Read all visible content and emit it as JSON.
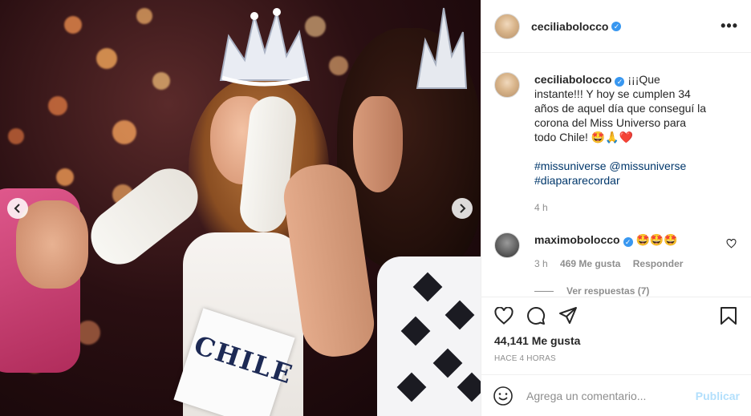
{
  "post": {
    "author": "ceciliabolocco",
    "more_label": "•••"
  },
  "caption": {
    "username": "ceciliabolocco",
    "text": " ¡¡¡Que instante!!! Y hoy se cumplen 34 años de aquel día que conseguí la corona del Miss Universo para todo Chile! 🤩🙏❤️",
    "hashtag1": "#missuniverse",
    "mention": "@missuniverse",
    "hashtag2": "#diapararecordar",
    "time": "4 h"
  },
  "reply": {
    "username": "maximobolocco",
    "text": " 🤩🤩🤩",
    "time": "3 h",
    "likes": "469 Me gusta",
    "reply_label": "Responder",
    "view_replies": "Ver respuestas (7)"
  },
  "stats": {
    "likes": "44,141 Me gusta",
    "date": "HACE 4 HORAS"
  },
  "composer": {
    "placeholder": "Agrega un comentario...",
    "publish_label": "Publicar"
  },
  "media": {
    "sash_text": "CHILE"
  },
  "colors": {
    "link": "#00376b",
    "verified": "#3897f0",
    "muted": "#8e8e8e",
    "publish_disabled": "#b2dffc"
  }
}
